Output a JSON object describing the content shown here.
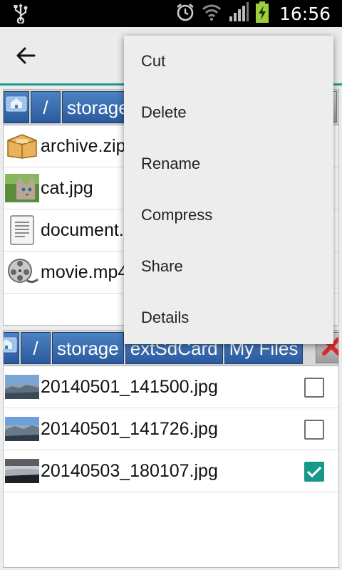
{
  "status_bar": {
    "time": "16:56",
    "icons": [
      "usb-icon",
      "alarm-icon",
      "wifi-icon",
      "signal-icon",
      "battery-charging-icon"
    ]
  },
  "app_bar": {
    "back_icon": "arrow-back-icon",
    "accent_color": "#1f9a8b"
  },
  "top_pane": {
    "path": [
      "/",
      "storage"
    ],
    "files": [
      {
        "name": "archive.zip",
        "icon": "archive-box-icon"
      },
      {
        "name": "cat.jpg",
        "icon": "image-thumbnail-cat"
      },
      {
        "name": "document.txt",
        "icon": "text-document-icon"
      },
      {
        "name": "movie.mp4",
        "icon": "film-reel-icon"
      }
    ]
  },
  "bottom_pane": {
    "path": [
      "/",
      "storage",
      "extSdCard",
      "My Files"
    ],
    "files": [
      {
        "name": "20140501_141500.jpg",
        "checked": false
      },
      {
        "name": "20140501_141726.jpg",
        "checked": false
      },
      {
        "name": "20140503_180107.jpg",
        "checked": true
      }
    ]
  },
  "context_menu": {
    "items": [
      "Cut",
      "Delete",
      "Rename",
      "Compress",
      "Share",
      "Details"
    ]
  },
  "colors": {
    "checkbox_checked": "#17988a",
    "breadcrumb": "#3b6fb2",
    "close_x": "#e02a2a"
  }
}
